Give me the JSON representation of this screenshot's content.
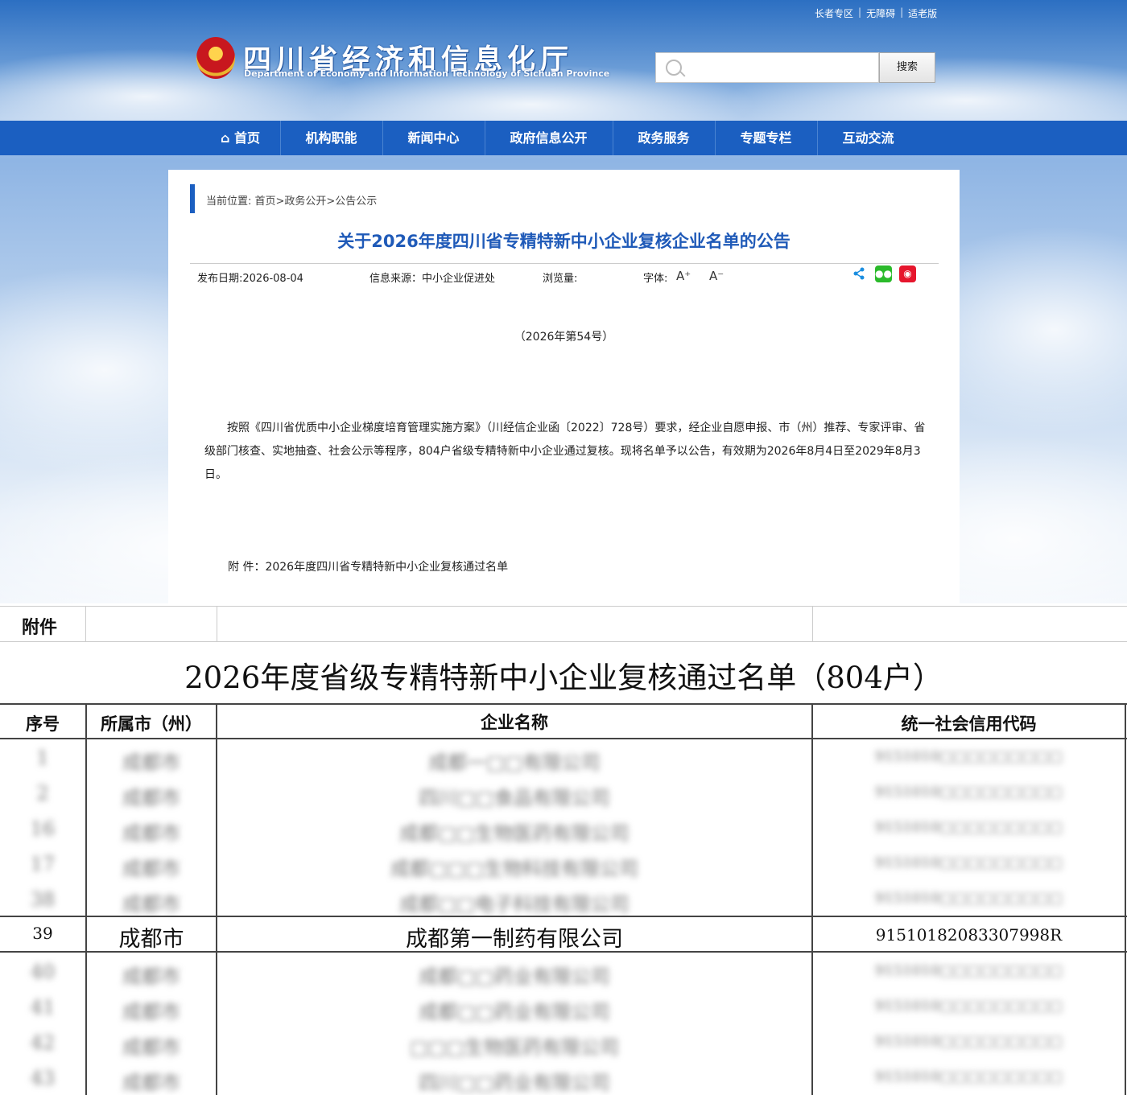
{
  "header": {
    "util_links": [
      "长者专区",
      "无障碍",
      "适老版"
    ],
    "site_name_cn": "四川省经济和信息化厅",
    "site_name_en": "Department of Economy and Information Technology of Sichuan Province",
    "search_placeholder": "",
    "search_button": "搜索"
  },
  "nav": [
    "首页",
    "机构职能",
    "新闻中心",
    "政府信息公开",
    "政务服务",
    "专题专栏",
    "互动交流"
  ],
  "article": {
    "breadcrumb": "当前位置: 首页>政务公开>公告公示",
    "title": "关于2026年度四川省专精特新中小企业复核企业名单的公告",
    "meta": {
      "date": "发布日期:2026-08-04",
      "source": "信息来源：中小企业促进处",
      "views": "浏览量:",
      "font_label": "字体:",
      "font_up": "A⁺",
      "font_down": "A⁻"
    },
    "doc_no": "（2026年第54号）",
    "paragraph": "按照《四川省优质中小企业梯度培育管理实施方案》（川经信企业函〔2022〕728号）要求，经企业自愿申报、市（州）推荐、专家评审、省级部门核查、实地抽查、社会公示等程序，804户省级专精特新中小企业通过复核。现将名单予以公告，有效期为2026年8月4日至2029年8月3日。",
    "attachment": "附  件：2026年度四川省专精特新中小企业复核通过名单"
  },
  "table": {
    "attachment_label": "附件",
    "title": "2026年度省级专精特新中小企业复核通过名单（804户）",
    "headers": [
      "序号",
      "所属市（州）",
      "企业名称",
      "统一社会信用代码"
    ],
    "blurred_rows_above": [
      [
        "1",
        "成都市",
        "成都一□□有限公司",
        "9151010□□□□□□□□□"
      ],
      [
        "2",
        "成都市",
        "四川□□食品有限公司",
        "9151010□□□□□□□□□"
      ],
      [
        "16",
        "成都市",
        "成都□□生物医药有限公司",
        "9151010□□□□□□□□□"
      ],
      [
        "17",
        "成都市",
        "成都□□□生物科技有限公司",
        "9151010□□□□□□□□□"
      ],
      [
        "38",
        "成都市",
        "成都□□电子科技有限公司",
        "9151010□□□□□□□□□"
      ]
    ],
    "highlight_row": [
      "39",
      "成都市",
      "成都第一制药有限公司",
      "91510182083307998R"
    ],
    "blurred_rows_below": [
      [
        "40",
        "成都市",
        "成都□□药业有限公司",
        "9151010□□□□□□□□□"
      ],
      [
        "41",
        "成都市",
        "成都□□药业有限公司",
        "9151010□□□□□□□□□"
      ],
      [
        "42",
        "成都市",
        "□□□生物医药有限公司",
        "9151010□□□□□□□□□"
      ],
      [
        "43",
        "成都市",
        "四川□□药业有限公司",
        "9151010□□□□□□□□□"
      ]
    ]
  }
}
